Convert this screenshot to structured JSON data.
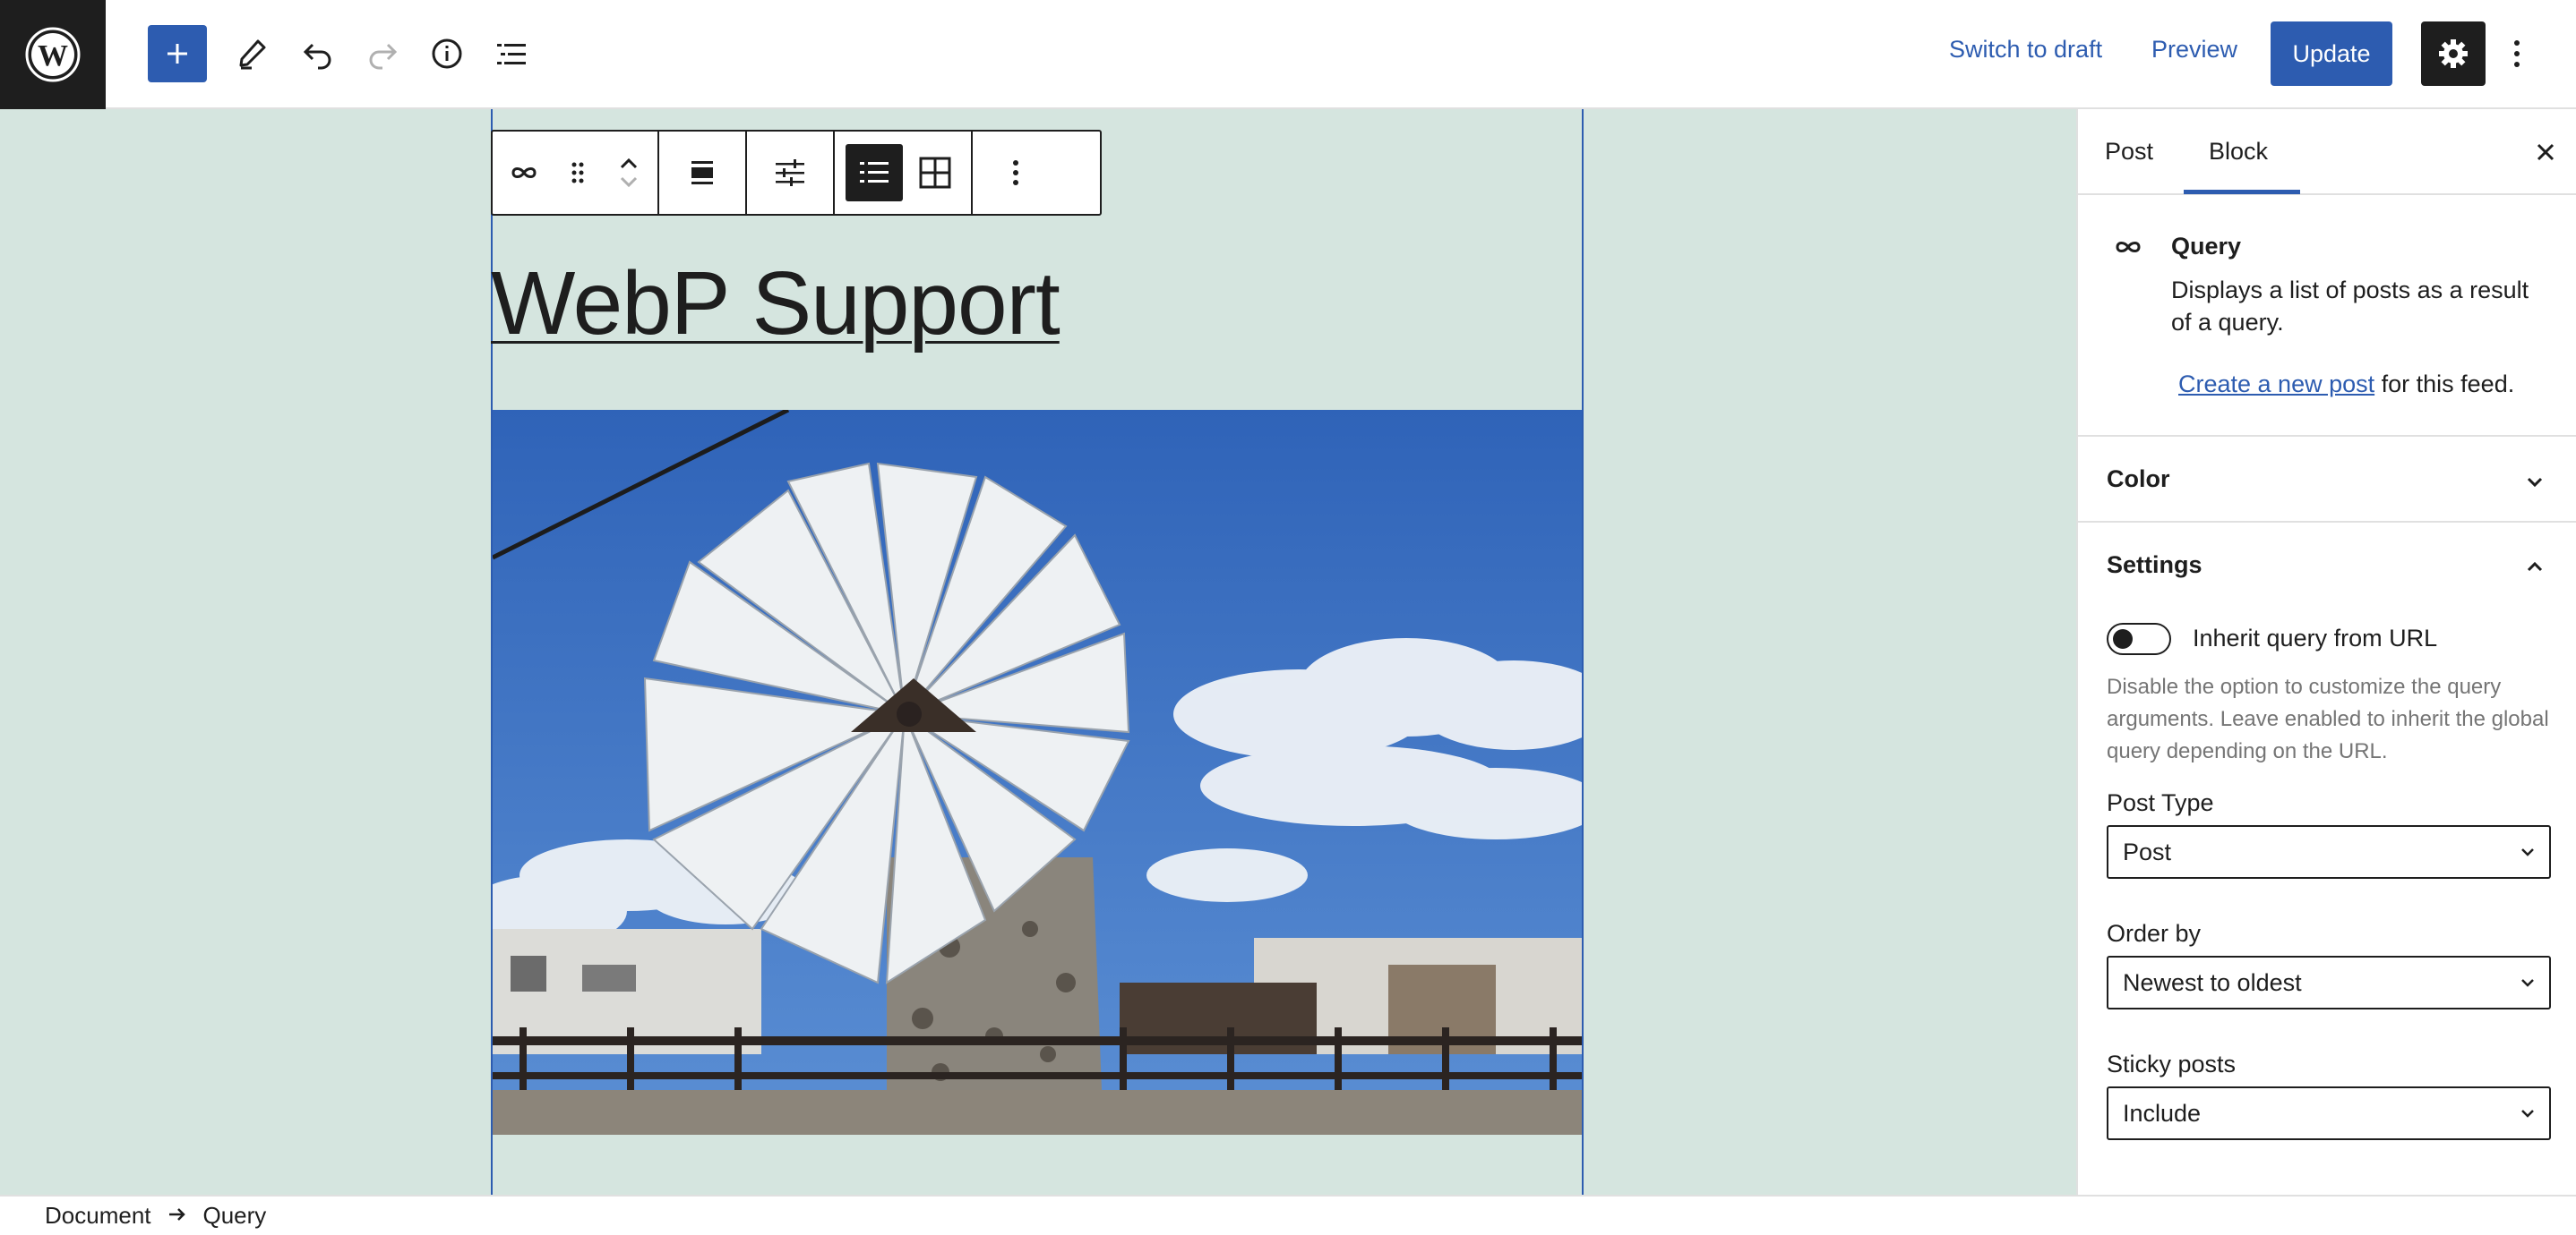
{
  "topbar": {
    "switch_to_draft": "Switch to draft",
    "preview": "Preview",
    "update": "Update"
  },
  "canvas": {
    "post_title": "WebP Support",
    "background": "#d5e5df"
  },
  "footer": {
    "breadcrumb": [
      "Document",
      "Query"
    ]
  },
  "sidebar": {
    "tabs": [
      "Post",
      "Block"
    ],
    "active_tab": "Block",
    "block": {
      "title": "Query",
      "description": "Displays a list of posts as a result of a query.",
      "link_text": "Create a new post",
      "link_suffix": " for this feed."
    },
    "color_panel": "Color",
    "settings_panel": {
      "title": "Settings",
      "toggle_label": "Inherit query from URL",
      "toggle_on": false,
      "help": "Disable the option to customize the query arguments. Leave enabled to inherit the global query depending on the URL.",
      "post_type_label": "Post Type",
      "post_type_value": "Post",
      "order_by_label": "Order by",
      "order_by_value": "Newest to oldest",
      "sticky_label": "Sticky posts",
      "sticky_value": "Include"
    }
  },
  "colors": {
    "accent": "#2d5cb0",
    "dark": "#1e1e1e"
  }
}
